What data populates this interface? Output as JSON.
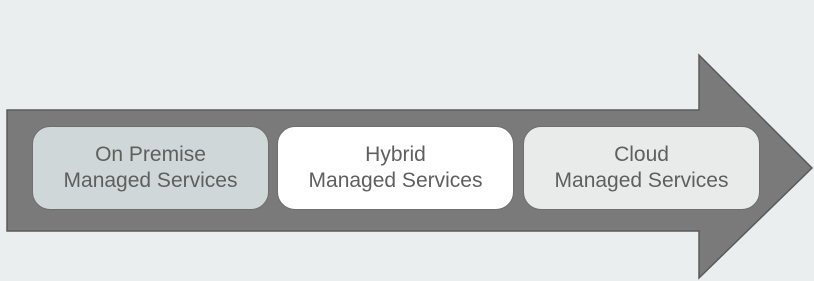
{
  "diagram": {
    "stages": [
      {
        "line1": "On Premise",
        "line2": "Managed Services"
      },
      {
        "line1": "Hybrid",
        "line2": "Managed Services"
      },
      {
        "line1": "Cloud",
        "line2": "Managed Services"
      }
    ],
    "colors": {
      "background": "#eaeeef",
      "arrow_fill": "#7a7a7a",
      "arrow_stroke": "#5a5a5a",
      "stage_on_premise": "#cfd7d8",
      "stage_hybrid": "#ffffff",
      "stage_cloud": "#e9ebeb",
      "text": "#5f5f5f"
    }
  }
}
